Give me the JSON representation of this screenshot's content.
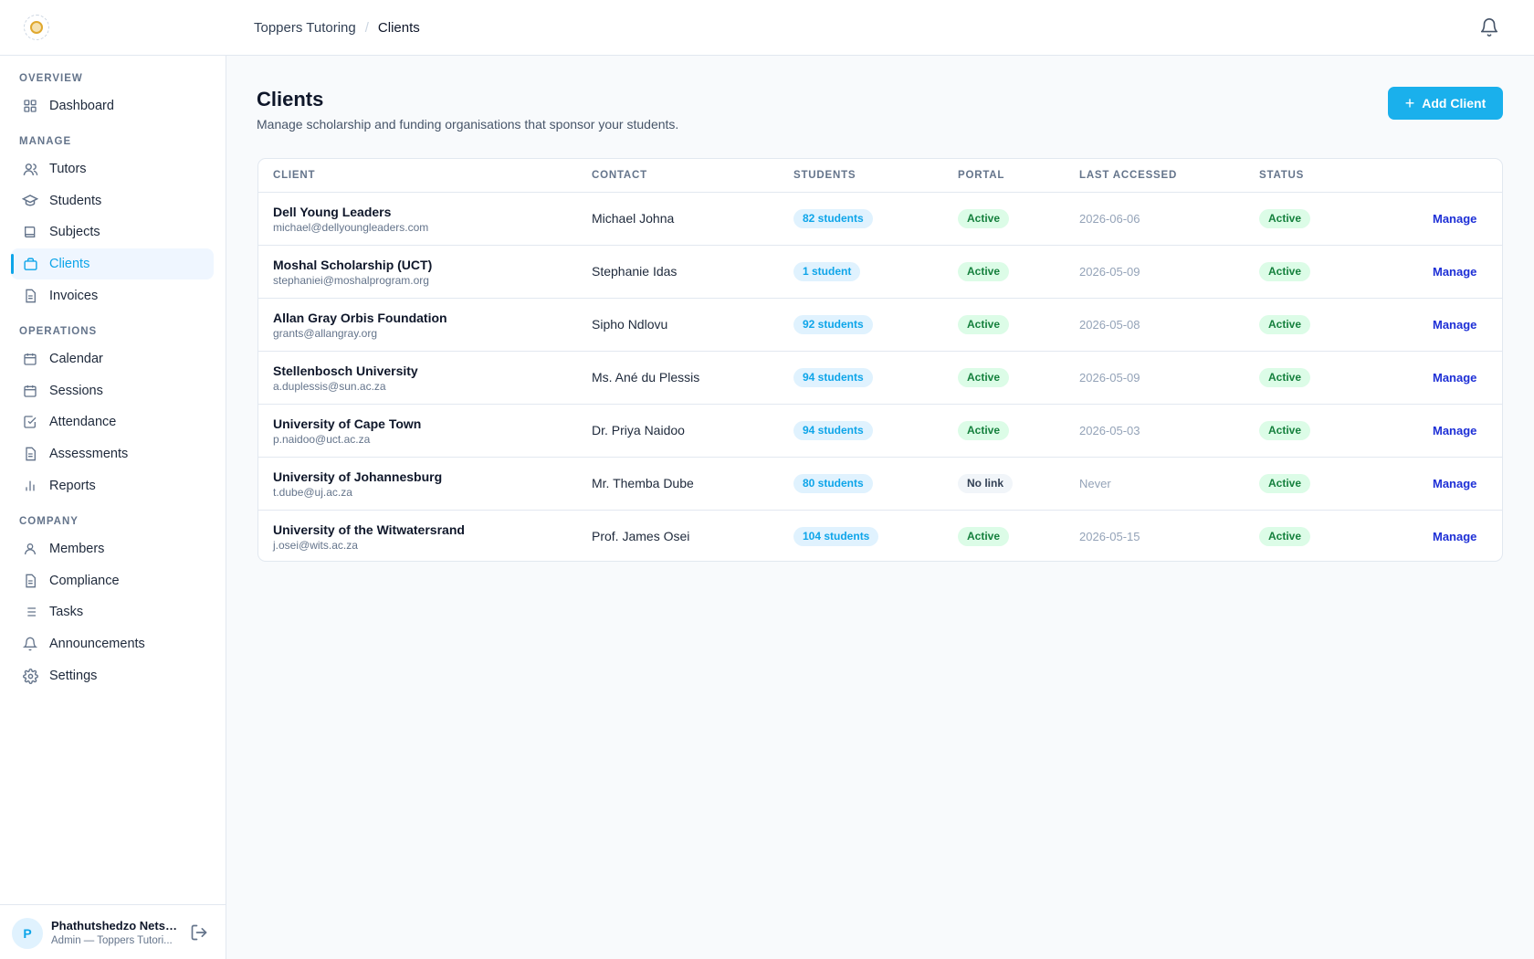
{
  "topbar": {
    "breadcrumb_parent": "Toppers Tutoring",
    "breadcrumb_separator": "/",
    "breadcrumb_current": "Clients",
    "notification_icon": "bell-icon"
  },
  "sidebar": {
    "sections": {
      "overview": "OVERVIEW",
      "manage": "MANAGE",
      "operations": "OPERATIONS",
      "company": "COMPANY"
    },
    "items": [
      {
        "label": "Dashboard",
        "icon": "grid-icon"
      },
      {
        "label": "Tutors",
        "icon": "users-icon"
      },
      {
        "label": "Students",
        "icon": "graduation-cap-icon"
      },
      {
        "label": "Subjects",
        "icon": "book-icon"
      },
      {
        "label": "Clients",
        "icon": "briefcase-icon",
        "active": true
      },
      {
        "label": "Invoices",
        "icon": "document-icon"
      },
      {
        "label": "Calendar",
        "icon": "calendar-icon"
      },
      {
        "label": "Sessions",
        "icon": "calendar-icon"
      },
      {
        "label": "Attendance",
        "icon": "check-square-icon"
      },
      {
        "label": "Assessments",
        "icon": "document-icon"
      },
      {
        "label": "Reports",
        "icon": "bar-chart-icon"
      },
      {
        "label": "Members",
        "icon": "user-icon"
      },
      {
        "label": "Compliance",
        "icon": "document-icon"
      },
      {
        "label": "Tasks",
        "icon": "list-icon"
      },
      {
        "label": "Announcements",
        "icon": "bell-icon"
      },
      {
        "label": "Settings",
        "icon": "gear-icon"
      }
    ],
    "user": {
      "initial": "P",
      "name": "Phathutshedzo Netsh...",
      "role": "Admin — Toppers Tutori..."
    }
  },
  "page": {
    "title": "Clients",
    "subtitle": "Manage scholarship and funding organisations that sponsor your students.",
    "add_button": "Add Client",
    "add_icon": "+"
  },
  "table": {
    "headers": {
      "client": "CLIENT",
      "contact": "CONTACT",
      "students": "STUDENTS",
      "portal": "PORTAL",
      "last_accessed": "LAST ACCESSED",
      "status": "STATUS"
    },
    "rows": [
      {
        "name": "Dell Young Leaders",
        "email": "michael@dellyoungleaders.com",
        "contact": "Michael Johna",
        "students": "82 students",
        "portal": "Active",
        "last_accessed": "2026-06-06",
        "status": "Active",
        "action": "Manage"
      },
      {
        "name": "Moshal Scholarship (UCT)",
        "email": "stephaniei@moshalprogram.org",
        "contact": "Stephanie Idas",
        "students": "1 student",
        "portal": "Active",
        "last_accessed": "2026-05-09",
        "status": "Active",
        "action": "Manage"
      },
      {
        "name": "Allan Gray Orbis Foundation",
        "email": "grants@allangray.org",
        "contact": "Sipho Ndlovu",
        "students": "92 students",
        "portal": "Active",
        "last_accessed": "2026-05-08",
        "status": "Active",
        "action": "Manage"
      },
      {
        "name": "Stellenbosch University",
        "email": "a.duplessis@sun.ac.za",
        "contact": "Ms. Ané du Plessis",
        "students": "94 students",
        "portal": "Active",
        "last_accessed": "2026-05-09",
        "status": "Active",
        "action": "Manage"
      },
      {
        "name": "University of Cape Town",
        "email": "p.naidoo@uct.ac.za",
        "contact": "Dr. Priya Naidoo",
        "students": "94 students",
        "portal": "Active",
        "last_accessed": "2026-05-03",
        "status": "Active",
        "action": "Manage"
      },
      {
        "name": "University of Johannesburg",
        "email": "t.dube@uj.ac.za",
        "contact": "Mr. Themba Dube",
        "students": "80 students",
        "portal": "No link",
        "last_accessed": "Never",
        "status": "Active",
        "action": "Manage"
      },
      {
        "name": "University of the Witwatersrand",
        "email": "j.osei@wits.ac.za",
        "contact": "Prof. James Osei",
        "students": "104 students",
        "portal": "Active",
        "last_accessed": "2026-05-15",
        "status": "Active",
        "action": "Manage"
      }
    ]
  },
  "colors": {
    "accent": "#1ab0ec",
    "active_text": "#0ea5e9",
    "manage_link": "#1d2fd6",
    "status_green": "#15803d"
  }
}
